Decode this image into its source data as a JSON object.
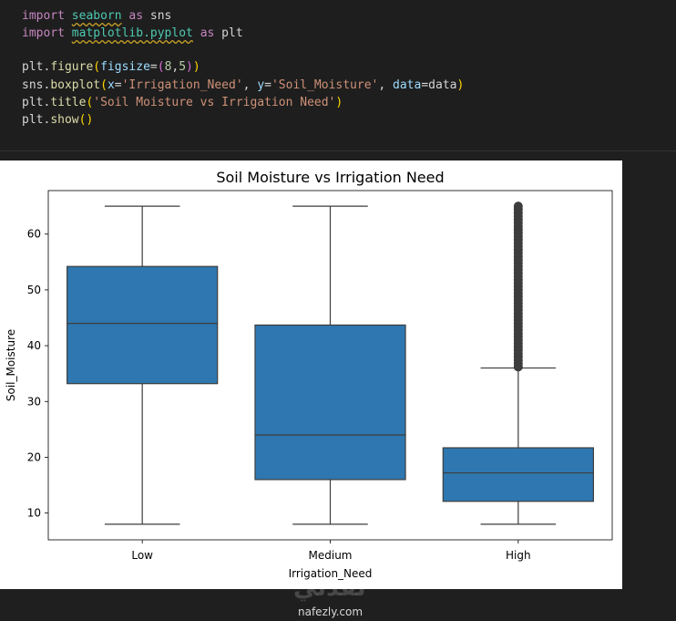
{
  "code": {
    "line1": {
      "kw": "import",
      "module": "seaborn",
      "as": "as",
      "alias": "sns"
    },
    "line2": {
      "kw": "import",
      "module": "matplotlib.pyplot",
      "as": "as",
      "alias": "plt"
    },
    "line3": {
      "obj": "plt",
      "fn": "figure",
      "param": "figsize",
      "v1": "8",
      "v2": "5"
    },
    "line4": {
      "obj": "sns",
      "fn": "boxplot",
      "p1": "x",
      "s1": "'Irrigation_Need'",
      "p2": "y",
      "s2": "'Soil_Moisture'",
      "p3": "data",
      "v3": "data"
    },
    "line5": {
      "obj": "plt",
      "fn": "title",
      "s1": "'Soil Moisture vs Irrigation Need'"
    },
    "line6": {
      "obj": "plt",
      "fn": "show"
    }
  },
  "chart_data": {
    "type": "box",
    "title": "Soil Moisture vs Irrigation Need",
    "xlabel": "Irrigation_Need",
    "ylabel": "Soil_Moisture",
    "categories": [
      "Low",
      "Medium",
      "High"
    ],
    "ylim": [
      5.2,
      67.8
    ],
    "yticks": [
      "10",
      "20",
      "30",
      "40",
      "50",
      "60"
    ],
    "box_color": "#2e77b0",
    "boxes": [
      {
        "category": "Low",
        "whisker_low": 8,
        "q1": 33.2,
        "median": 44.0,
        "q3": 54.2,
        "whisker_high": 65
      },
      {
        "category": "Medium",
        "whisker_low": 8,
        "q1": 16.0,
        "median": 24.0,
        "q3": 43.7,
        "whisker_high": 65
      },
      {
        "category": "High",
        "whisker_low": 8,
        "q1": 12.1,
        "median": 17.2,
        "q3": 21.7,
        "whisker_high": 36.0,
        "outliers": [
          36.2,
          36.8,
          37.4,
          38.0,
          38.6,
          39.2,
          39.8,
          40.4,
          41.0,
          41.6,
          42.2,
          42.8,
          43.4,
          44.0,
          44.6,
          45.2,
          45.8,
          46.4,
          47.0,
          47.6,
          48.2,
          48.8,
          49.4,
          50.0,
          50.6,
          51.2,
          51.8,
          52.4,
          53.0,
          53.6,
          54.2,
          54.8,
          55.4,
          56.0,
          56.6,
          57.2,
          57.8,
          58.4,
          59.0,
          59.6,
          60.2,
          60.8,
          61.4,
          62.0,
          62.6,
          63.2,
          63.8,
          64.4,
          65.0
        ]
      }
    ]
  },
  "watermark": {
    "arabic": "نفذلي",
    "url": "nafezly.com"
  }
}
